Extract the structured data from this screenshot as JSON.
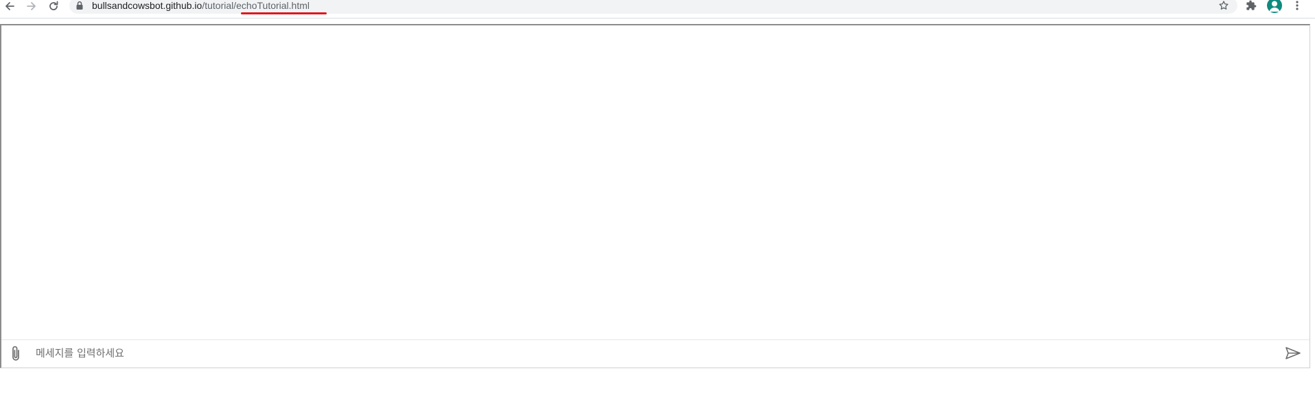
{
  "browser": {
    "url_host": "bullsandcowsbot.github.io",
    "url_path": "/tutorial/echoTutorial.html",
    "icons": {
      "back": "arrow-left-icon",
      "forward": "arrow-right-icon",
      "reload": "reload-icon",
      "lock": "lock-icon",
      "bookmark": "star-icon",
      "extensions": "puzzle-icon",
      "profile": "avatar-icon",
      "menu": "kebab-icon"
    },
    "highlight_color": "#e0141e"
  },
  "chat": {
    "input_placeholder": "메세지를 입력하세요",
    "attach_icon": "paperclip-icon",
    "send_icon": "send-icon"
  }
}
